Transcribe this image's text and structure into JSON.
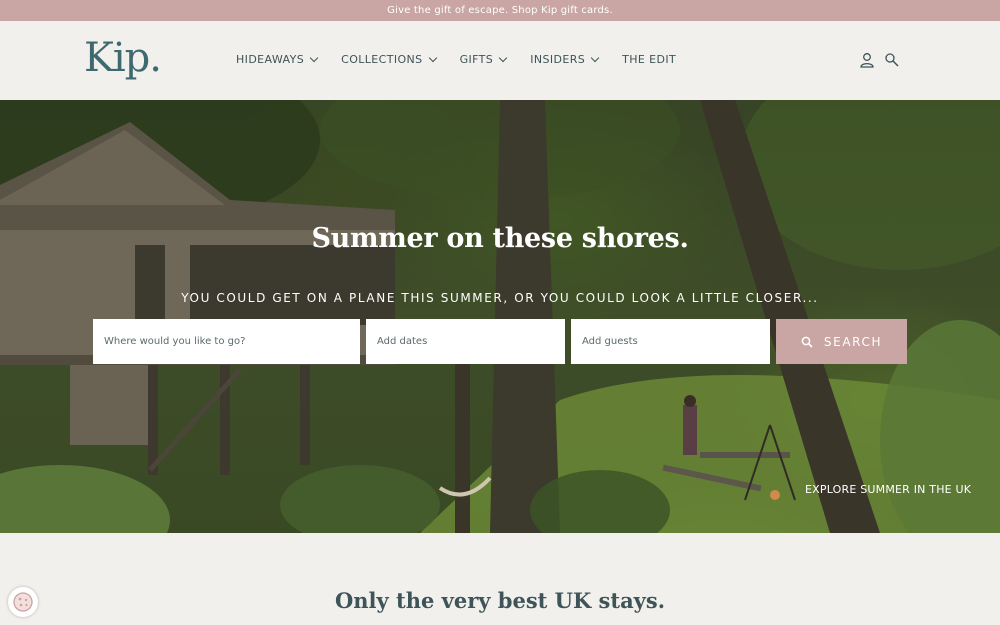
{
  "promo": {
    "text": "Give the gift of escape. Shop Kip gift cards."
  },
  "header": {
    "logo": "Kip.",
    "nav": [
      {
        "label": "HIDEAWAYS",
        "dropdown": true
      },
      {
        "label": "COLLECTIONS",
        "dropdown": true
      },
      {
        "label": "GIFTS",
        "dropdown": true
      },
      {
        "label": "INSIDERS",
        "dropdown": true
      },
      {
        "label": "THE EDIT",
        "dropdown": false
      }
    ],
    "icons": [
      "user-icon",
      "search-icon"
    ]
  },
  "hero": {
    "title": "Summer on these shores.",
    "subtitle": "YOU COULD GET ON A PLANE THIS SUMMER, OR YOU COULD LOOK A LITTLE CLOSER...",
    "search": {
      "destination_placeholder": "Where would you like to go?",
      "dates_placeholder": "Add dates",
      "guests_placeholder": "Add guests",
      "button_label": "SEARCH"
    },
    "explore_link": "EXPLORE SUMMER IN THE UK"
  },
  "section": {
    "title": "Only the very best UK stays."
  },
  "colors": {
    "accent": "#c9a5a3",
    "text": "#3e5458",
    "logo": "#3e6a6f",
    "background": "#f1f0ec"
  }
}
